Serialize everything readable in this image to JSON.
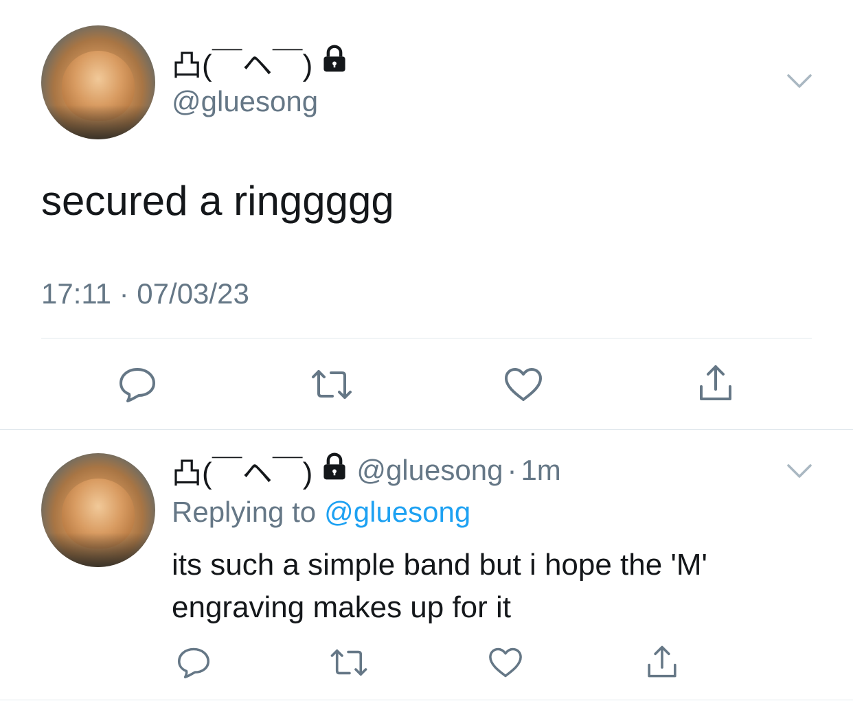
{
  "main_tweet": {
    "display_name": "凸(￣ヘ￣)",
    "handle": "@gluesong",
    "text": "secured a ringgggg",
    "timestamp": "17:11 · 07/03/23",
    "actions": [
      "reply-icon",
      "retweet-icon",
      "like-icon",
      "share-icon"
    ]
  },
  "reply_tweet": {
    "display_name": "凸(￣ヘ￣)",
    "handle": "@gluesong",
    "separator": "·",
    "age": "1m",
    "replying_prefix": "Replying to",
    "replying_handle": "@gluesong",
    "text": "its such a simple band but i hope the 'M' engraving makes up for it",
    "actions": [
      "reply-icon",
      "retweet-icon",
      "like-icon",
      "share-icon"
    ]
  },
  "colors": {
    "text": "#14171a",
    "muted": "#657786",
    "link": "#1da1f2",
    "divider": "#e1e8ed",
    "chevron": "#aab8c2"
  }
}
